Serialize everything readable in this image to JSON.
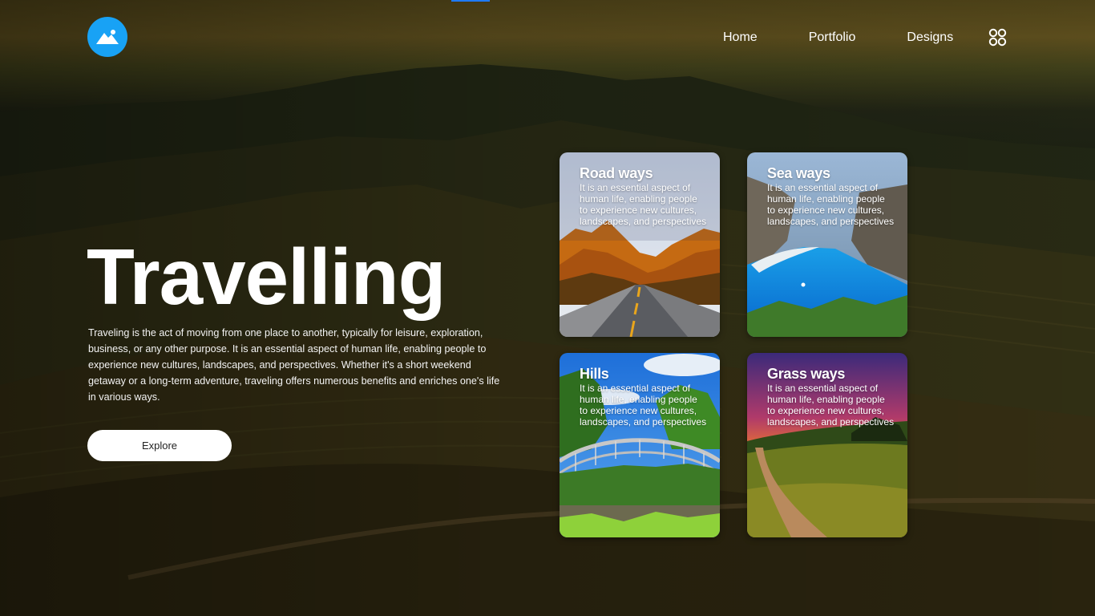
{
  "colors": {
    "accent": "#18a2f5",
    "top_mark": "#1f7bff",
    "button_bg": "#ffffff",
    "text": "#ffffff"
  },
  "header": {
    "logo_icon": "mountain-icon",
    "nav": [
      "Home",
      "Portfolio",
      "Designs"
    ],
    "menu_icon": "apps-grid-icon"
  },
  "hero": {
    "title": "Travelling",
    "description": "Traveling is the act of moving from one place to another, typically for leisure, exploration, business, or any other purpose. It is an essential aspect of human life, enabling people to experience new cultures, landscapes, and perspectives. Whether it's a short weekend getaway or a long-term adventure, traveling offers numerous benefits and enriches one's life in various ways.",
    "button": "Explore"
  },
  "cards": [
    {
      "title": "Road ways",
      "text": "It is an essential aspect of human life, enabling people to experience new cultures, landscapes, and perspectives",
      "scene": "autumn-road"
    },
    {
      "title": "Sea ways",
      "text": "It is an essential aspect of human life, enabling people to experience new cultures, landscapes, and perspectives",
      "scene": "blue-bay"
    },
    {
      "title": "Hills",
      "text": "It is an essential aspect of human life, enabling people to experience new cultures, landscapes, and perspectives",
      "scene": "iron-bridge"
    },
    {
      "title": "Grass ways",
      "text": "It is an essential aspect of human life, enabling people to experience new cultures, landscapes, and perspectives",
      "scene": "sunset-path"
    }
  ]
}
